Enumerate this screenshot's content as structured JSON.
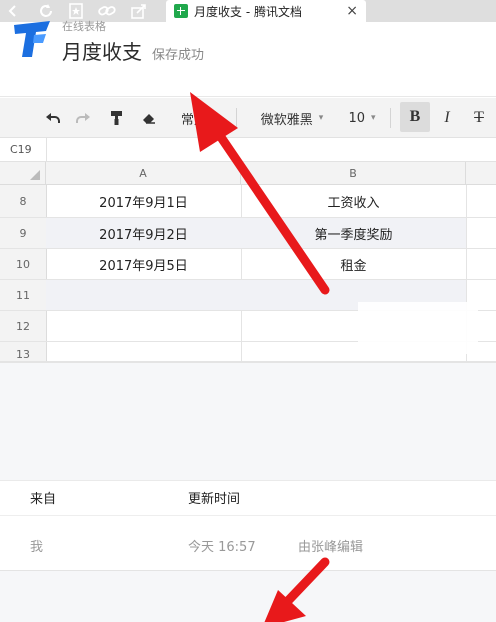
{
  "browser": {
    "tab_title": "月度收支 - 腾讯文档",
    "tab_close": "×"
  },
  "header": {
    "brand": "在线表格",
    "doc_title": "月度收支",
    "save_status": "保存成功"
  },
  "toolbar": {
    "format_label": "常规",
    "font_name": "微软雅黑",
    "font_size": "10",
    "bold_label": "B",
    "italic_label": "I",
    "strike_label": "T",
    "dropdown_icon": "▾"
  },
  "sheet": {
    "cell_ref": "C19",
    "col_headers": [
      "A",
      "B"
    ],
    "rows": [
      {
        "num": "8",
        "a": "2017年9月1日",
        "b": "工资收入"
      },
      {
        "num": "9",
        "a": "2017年9月2日",
        "b": "第一季度奖励"
      },
      {
        "num": "10",
        "a": "2017年9月5日",
        "b": "租金"
      },
      {
        "num": "11",
        "a": "",
        "b": ""
      },
      {
        "num": "12",
        "a": "",
        "b": ""
      },
      {
        "num": "13",
        "a": "",
        "b": ""
      }
    ]
  },
  "history": {
    "col_from": "来自",
    "col_time": "更新时间",
    "from": "我",
    "time": "今天 16:57",
    "editor": "由张峰编辑"
  },
  "colors": {
    "brand_blue": "#1c6fe0",
    "favicon_green": "#20a84c",
    "arrow_red": "#e8191b"
  }
}
